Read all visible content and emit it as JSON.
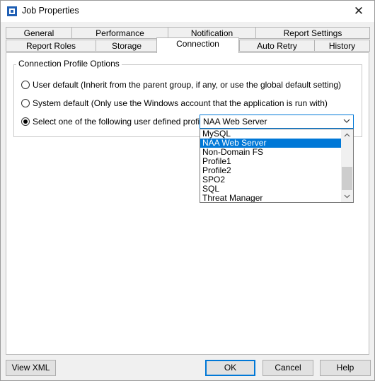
{
  "window": {
    "title": "Job Properties",
    "close_symbol": "✕"
  },
  "tabs": {
    "row1": [
      "General",
      "Performance",
      "Notification",
      "Report Settings"
    ],
    "row2": [
      "Report Roles",
      "Storage",
      "Connection",
      "Auto Retry",
      "History"
    ],
    "active": "Connection"
  },
  "connection": {
    "group_title": "Connection Profile Options",
    "options": [
      {
        "label": "User default (Inherit from the parent group, if any, or use the global default setting)",
        "checked": false
      },
      {
        "label": "System default (Only use the Windows account that the application is run with)",
        "checked": false
      },
      {
        "label": "Select one of the following user defined profiles:",
        "checked": true
      }
    ],
    "profile_select": {
      "value": "NAA Web Server",
      "options": [
        "MySQL",
        "NAA Web Server",
        "Non-Domain FS",
        "Profile1",
        "Profile2",
        "SPO2",
        "SQL",
        "Threat Manager"
      ],
      "selected_index": 1
    }
  },
  "buttons": {
    "view_xml": "View XML",
    "ok": "OK",
    "cancel": "Cancel",
    "help": "Help"
  },
  "colors": {
    "accent": "#0078d7",
    "tab_border": "#b5b5b5"
  }
}
